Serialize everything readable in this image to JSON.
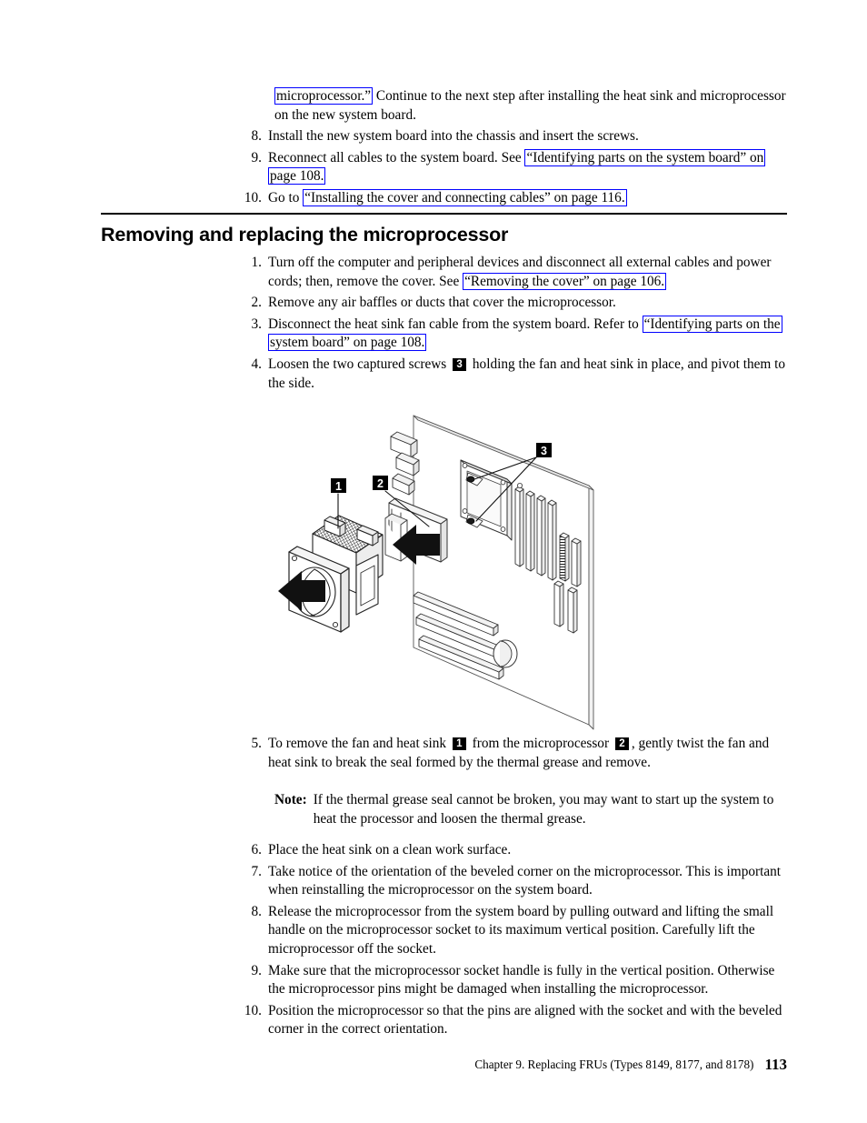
{
  "document": {
    "footer_text": "Chapter 9. Replacing FRUs (Types 8149, 8177, and 8178)",
    "page_number": "113"
  },
  "colors": {
    "xref_border": "#0000FF",
    "callout_background": "#000000",
    "callout_text": "#FFFFFF",
    "text": "#000000"
  },
  "top_continuation": {
    "xref": "microprocessor.”",
    "text": " Continue to the next step after installing the heat sink and microprocessor on the new system board."
  },
  "top_steps": [
    {
      "number": "8.",
      "parts": [
        {
          "type": "text",
          "value": "Install the new system board into the chassis and insert the screws."
        }
      ]
    },
    {
      "number": "9.",
      "parts": [
        {
          "type": "text",
          "value": "Reconnect all cables to the system board. See "
        },
        {
          "type": "xref",
          "value": "“Identifying parts on the system board” on page 108."
        }
      ]
    },
    {
      "number": "10.",
      "parts": [
        {
          "type": "text",
          "value": "Go to "
        },
        {
          "type": "xref",
          "value": "“Installing the cover and connecting cables” on page 116."
        }
      ]
    }
  ],
  "section": {
    "heading": "Removing and replacing the microprocessor"
  },
  "steps_before_figure": [
    {
      "number": "1.",
      "text_a": "Turn off the computer and peripheral devices and disconnect all external cables and power cords; then, remove the cover. See ",
      "xref": "“Removing the cover” on page 106.",
      "text_b": ""
    },
    {
      "number": "2.",
      "text_a": "Remove any air baffles or ducts that cover the microprocessor.",
      "xref": "",
      "text_b": ""
    },
    {
      "number": "3.",
      "text_a": "Disconnect the heat sink fan cable from the system board. Refer to ",
      "xref": "“Identifying parts on the system board” on page 108.",
      "text_b": ""
    },
    {
      "number": "4.",
      "text_a": "Loosen the two captured screws ",
      "chip": "3",
      "text_b": " holding the fan and heat sink in place, and pivot them to the side."
    }
  ],
  "figure": {
    "alt": "Exploded isometric line drawing of a system board with fan and heat sink assembly, microprocessor, and two captured screws",
    "callouts": [
      {
        "id": "1",
        "label": "1",
        "meaning": "fan and heat sink"
      },
      {
        "id": "2",
        "label": "2",
        "meaning": "microprocessor"
      },
      {
        "id": "3",
        "label": "3",
        "meaning": "captured screws"
      }
    ]
  },
  "step5": {
    "number": "5.",
    "text_a": "To remove the fan and heat sink ",
    "chip_a": "1",
    "text_b": " from the microprocessor ",
    "chip_b": "2",
    "text_c": ", gently twist the fan and heat sink to break the seal formed by the thermal grease and remove."
  },
  "note": {
    "label": "Note:",
    "text": "If the thermal grease seal cannot be broken, you may want to start up the system to heat the processor and loosen the thermal grease."
  },
  "steps_after_figure": [
    {
      "number": "6.",
      "text": "Place the heat sink on a clean work surface."
    },
    {
      "number": "7.",
      "text": "Take notice of the orientation of the beveled corner on the microprocessor. This is important when reinstalling the microprocessor on the system board."
    },
    {
      "number": "8.",
      "text": "Release the microprocessor from the system board by pulling outward and lifting the small handle on the microprocessor socket to its maximum vertical position. Carefully lift the microprocessor off the socket."
    },
    {
      "number": "9.",
      "text": "Make sure that the microprocessor socket handle is fully in the vertical position. Otherwise the microprocessor pins might be damaged when installing the microprocessor."
    },
    {
      "number": "10.",
      "text": "Position the microprocessor so that the pins are aligned with the socket and with the beveled corner in the correct orientation."
    }
  ]
}
